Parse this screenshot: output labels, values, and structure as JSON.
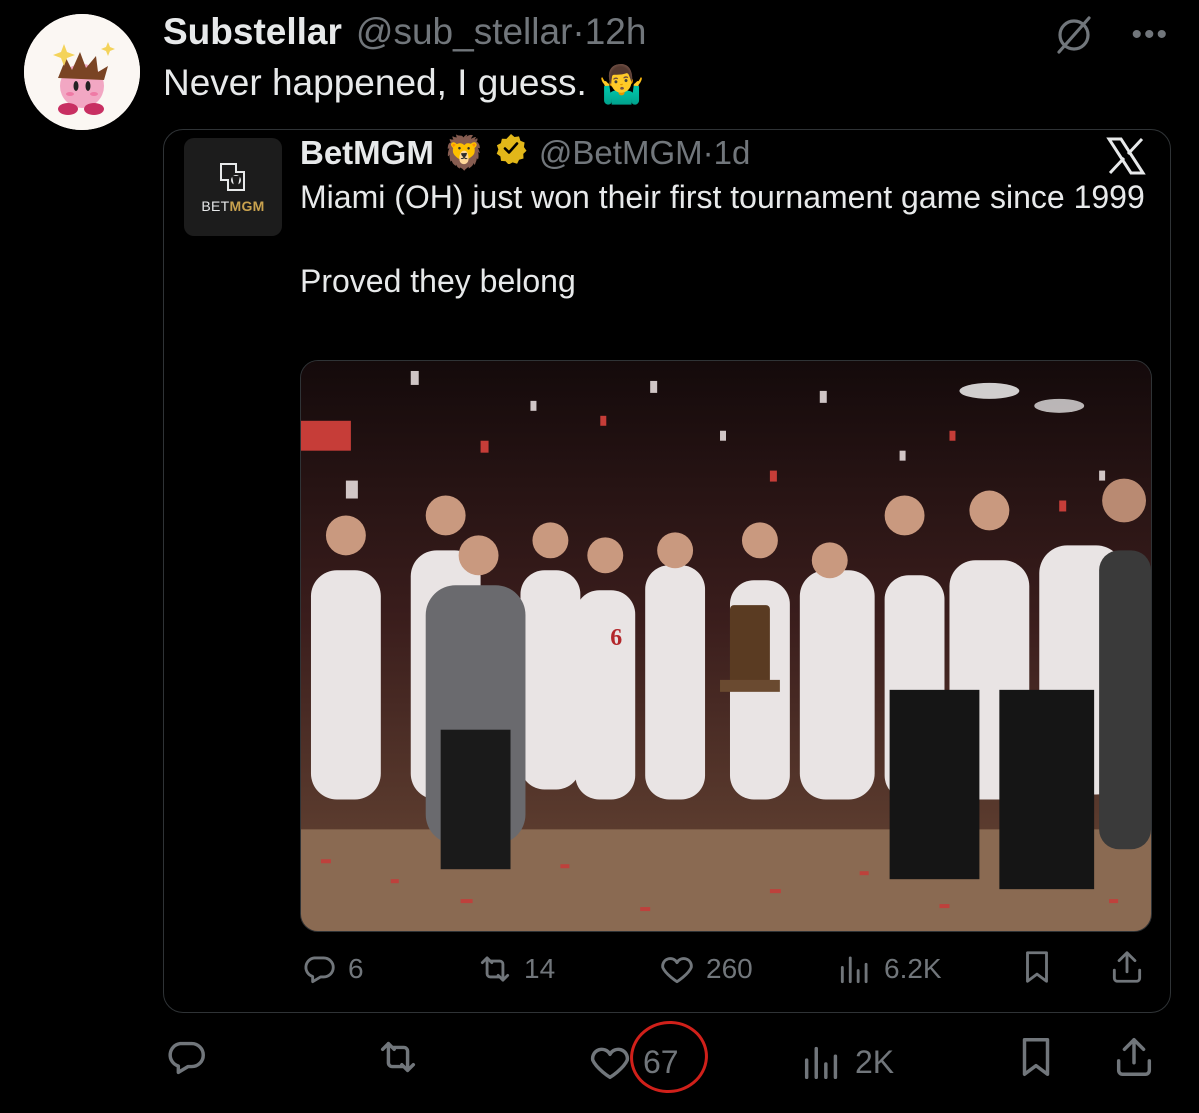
{
  "author": {
    "display_name": "Substellar",
    "handle": "@sub_stellar",
    "separator": "·",
    "time": "12h"
  },
  "tweet": {
    "text": "Never happened, I guess.",
    "emoji": "🤷‍♂️"
  },
  "quote": {
    "logo_text_a": "BET",
    "logo_text_b": "MGM",
    "display_name": "BetMGM",
    "name_emoji": "🦁",
    "handle": "@BetMGM",
    "separator": "·",
    "time": "1d",
    "text_line1": "Miami (OH) just won their first tournament game since 1999",
    "text_line2": "Proved they belong",
    "stats": {
      "replies": "6",
      "reposts": "14",
      "likes": "260",
      "views": "6.2K"
    }
  },
  "stats": {
    "replies": "",
    "reposts": "",
    "likes": "67",
    "views": "2K"
  },
  "colors": {
    "background": "#000000",
    "text": "#e7e9ea",
    "muted": "#71767b",
    "border": "#2f3336",
    "annotation": "#d0201a",
    "verified": "#e2b719"
  },
  "icons": [
    "grok-icon",
    "more-icon",
    "x-logo-icon",
    "reply-icon",
    "repost-icon",
    "like-icon",
    "views-icon",
    "bookmark-icon",
    "share-icon",
    "verified-badge-icon"
  ]
}
